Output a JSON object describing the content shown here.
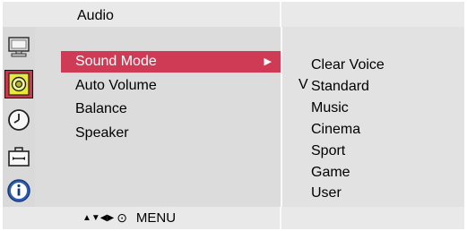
{
  "header": {
    "title": "Audio"
  },
  "sidebar": {
    "icons": [
      {
        "name": "monitor-icon",
        "selected": false
      },
      {
        "name": "speaker-icon",
        "selected": true
      },
      {
        "name": "clock-icon",
        "selected": false
      },
      {
        "name": "toolbox-icon",
        "selected": false
      },
      {
        "name": "info-icon",
        "selected": false
      }
    ]
  },
  "menu": {
    "items": [
      {
        "label": "Sound Mode",
        "selected": true,
        "arrow": "▶"
      },
      {
        "label": "Auto Volume"
      },
      {
        "label": "Balance"
      },
      {
        "label": "Speaker"
      }
    ]
  },
  "submenu": {
    "check_mark": "V",
    "options": [
      "Clear Voice",
      "Standard",
      "Music",
      "Cinema",
      "Sport",
      "Game",
      "User"
    ],
    "checked_index": 1
  },
  "footer": {
    "nav_arrows": "▲▼◀▶",
    "ok_symbol": "⊙",
    "menu_label": "MENU"
  },
  "colors": {
    "highlight": "#cf3a55",
    "icon_highlight": "#c8384f",
    "panel": "#dcdcdc",
    "bar": "#e9e9e9"
  }
}
